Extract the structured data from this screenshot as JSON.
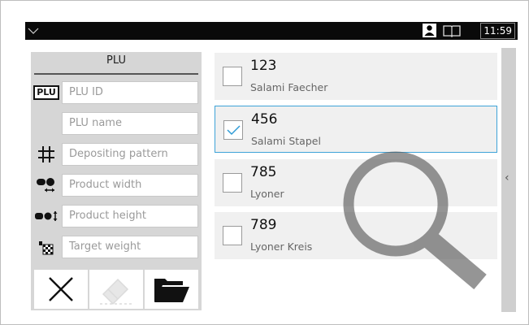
{
  "statusbar": {
    "menu_icon": "chevron-down-icon",
    "user_icon": "user-icon",
    "book_icon": "book-icon",
    "time": "11:59"
  },
  "left_panel": {
    "title": "PLU",
    "fields": [
      {
        "icon": "plu-badge-icon",
        "badge": "PLU",
        "placeholder": "PLU ID"
      },
      {
        "icon": "",
        "placeholder": "PLU name"
      },
      {
        "icon": "grid-hash-icon",
        "placeholder": "Depositing pattern"
      },
      {
        "icon": "product-width-icon",
        "placeholder": "Product width"
      },
      {
        "icon": "product-height-icon",
        "placeholder": "Product height"
      },
      {
        "icon": "target-weight-icon",
        "placeholder": "Target weight"
      }
    ],
    "buttons": [
      {
        "name": "clear-button",
        "icon": "close-icon"
      },
      {
        "name": "eraser-button",
        "icon": "eraser-icon",
        "disabled": true
      },
      {
        "name": "open-folder-button",
        "icon": "folder-icon"
      }
    ]
  },
  "list": {
    "items": [
      {
        "number": "123",
        "name": "Salami Faecher",
        "checked": false
      },
      {
        "number": "456",
        "name": "Salami Stapel",
        "checked": true
      },
      {
        "number": "785",
        "name": "Lyoner",
        "checked": false
      },
      {
        "number": "789",
        "name": "Lyoner Kreis",
        "checked": false
      }
    ]
  },
  "overlay_icon": "magnifier-icon",
  "side_handle_icon": "chevron-left-icon"
}
